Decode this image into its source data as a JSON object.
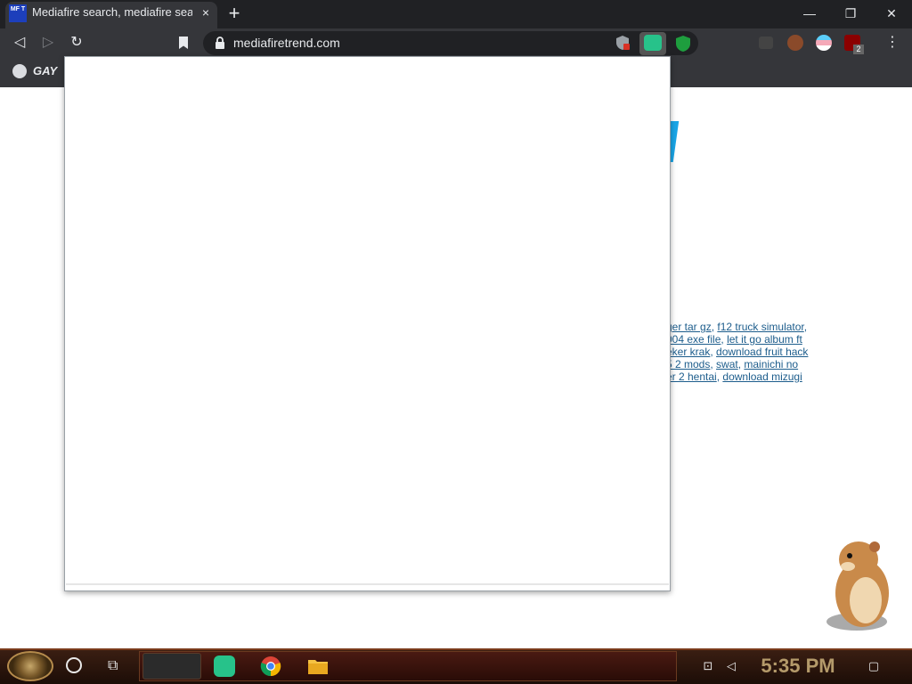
{
  "browser": {
    "tab_title": "Mediafire search, mediafire sea",
    "favicon_text": "MF T",
    "tab_close": "×",
    "new_tab": "+",
    "window": {
      "minimize": "—",
      "restore": "❐",
      "close": "✕"
    }
  },
  "toolbar": {
    "back": "◁",
    "forward": "▷",
    "reload": "↻",
    "url": "mediafiretrend.com",
    "menu": "⋮",
    "ext_badge": "2"
  },
  "bookmarks": {
    "items": [
      {
        "label": "GAY F"
      }
    ]
  },
  "page": {
    "link_lines": [
      [
        {
          "text": "ger tar gz"
        },
        {
          "sep": ", "
        },
        {
          "text": "f12 truck simulator"
        },
        {
          "sep": ","
        }
      ],
      [
        {
          "text": "004 exe file"
        },
        {
          "sep": ", "
        },
        {
          "text": "let it go album ft"
        }
      ],
      [
        {
          "text": "eker krak"
        },
        {
          "sep": ", "
        },
        {
          "text": "download fruit hack"
        }
      ],
      [
        {
          "text": "5 2 mods"
        },
        {
          "sep": ", "
        },
        {
          "text": "swat"
        },
        {
          "sep": ", "
        },
        {
          "text": "mainichi no"
        }
      ],
      [
        {
          "text": "er 2 hentai"
        },
        {
          "sep": ", "
        },
        {
          "text": "download mizugi"
        }
      ]
    ]
  },
  "taskbar": {
    "clock": "5:35 PM",
    "task_view": "⧉",
    "notification": "▢"
  },
  "icons": {
    "favicon": "mediafire-trend-icon",
    "lock": "lock-icon",
    "extension_green": "green-note-extension-icon",
    "extension_shield": "green-shield-extension-icon",
    "hamster": "hamster-mascot"
  },
  "colors": {
    "chrome_dark": "#202124",
    "chrome_toolbar": "#35363a",
    "link": "#1d5d8c",
    "taskbar": "#3a1e12",
    "clock": "#b49a6a"
  }
}
